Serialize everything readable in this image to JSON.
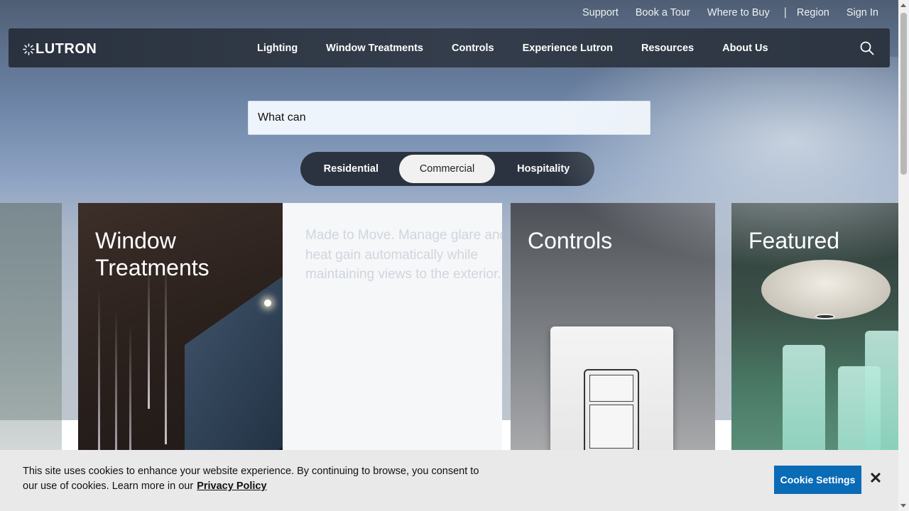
{
  "utility_nav": {
    "support": "Support",
    "book_tour": "Book a Tour",
    "where_to_buy": "Where to Buy",
    "separator": "|",
    "region": "Region",
    "sign_in": "Sign In"
  },
  "brand": {
    "logo_text": "LUTRON"
  },
  "main_nav": {
    "items": [
      {
        "label": "Lighting"
      },
      {
        "label": "Window Treatments"
      },
      {
        "label": "Controls"
      },
      {
        "label": "Experience Lutron"
      },
      {
        "label": "Resources"
      },
      {
        "label": "About Us"
      }
    ]
  },
  "search": {
    "value": "What can",
    "icon": "search-icon"
  },
  "segments": {
    "items": [
      {
        "label": "Residential"
      },
      {
        "label": "Commercial"
      },
      {
        "label": "Hospitality"
      }
    ],
    "selected": "Commercial"
  },
  "cards": {
    "window_treatments": {
      "title_line1": "Window",
      "title_line2": "Treatments"
    },
    "description": "Made to Move. Manage glare and heat gain automatically while maintaining views to the exterior.",
    "controls": {
      "title": "Controls"
    },
    "featured": {
      "title": "Featured"
    }
  },
  "cookie_banner": {
    "message": "This site uses cookies to enhance your website experience. By continuing to browse, you consent to our use of cookies. Learn more in our",
    "privacy_link": "Privacy Policy",
    "settings_button": "Cookie Settings",
    "close_symbol": "✕"
  },
  "colors": {
    "nav_bg": "#2b3442",
    "segment_bg": "#2b3340",
    "cookie_button": "#0a6bb6",
    "cookie_bg": "#e9e9e9"
  }
}
